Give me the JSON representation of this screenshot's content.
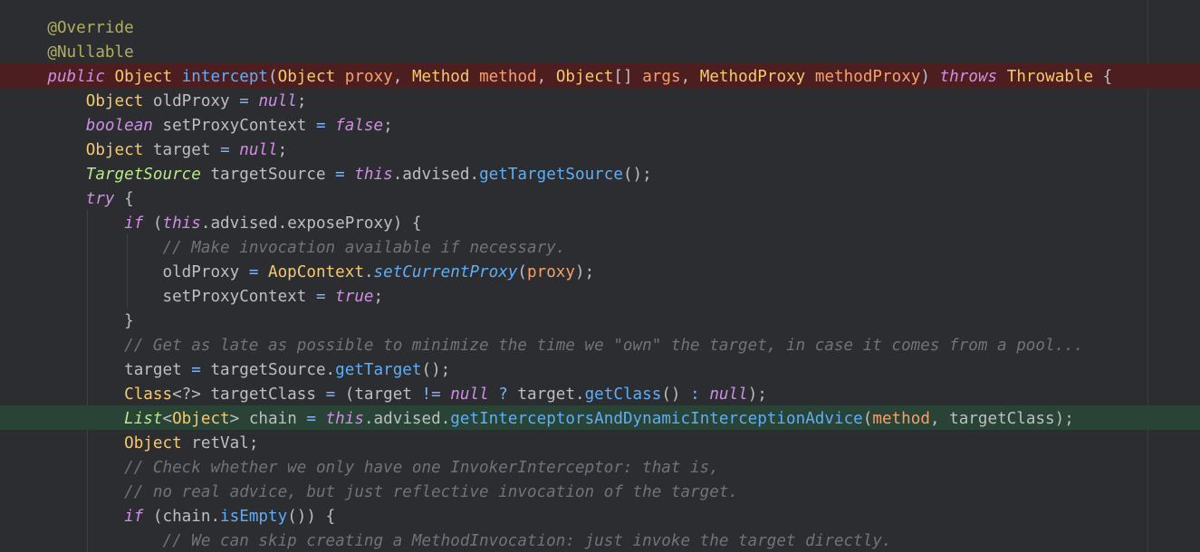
{
  "editor": {
    "language": "Java",
    "colors": {
      "background": "#2b2d30",
      "breakpoint_line": "#4d1e20",
      "execution_line": "#294436",
      "keyword": "#cf8ee4",
      "type": "#f7c86d",
      "parameter": "#f79f6c",
      "method_call": "#5fadf7",
      "comment": "#6f737a",
      "annotation": "#b3ae60"
    },
    "lines": [
      {
        "kind": "normal",
        "tokens": [
          {
            "t": "    ",
            "c": "punc"
          },
          {
            "t": "@Override",
            "c": "ann"
          }
        ]
      },
      {
        "kind": "normal",
        "tokens": [
          {
            "t": "    ",
            "c": "punc"
          },
          {
            "t": "@Nullable",
            "c": "ann"
          }
        ]
      },
      {
        "kind": "breakpoint",
        "tokens": [
          {
            "t": "    ",
            "c": "punc"
          },
          {
            "t": "public",
            "c": "kw"
          },
          {
            "t": " ",
            "c": "punc"
          },
          {
            "t": "Object",
            "c": "type"
          },
          {
            "t": " ",
            "c": "punc"
          },
          {
            "t": "intercept",
            "c": "method"
          },
          {
            "t": "(",
            "c": "punc"
          },
          {
            "t": "Object",
            "c": "type"
          },
          {
            "t": " ",
            "c": "punc"
          },
          {
            "t": "proxy",
            "c": "param"
          },
          {
            "t": ", ",
            "c": "punc"
          },
          {
            "t": "Method",
            "c": "type"
          },
          {
            "t": " ",
            "c": "punc"
          },
          {
            "t": "method",
            "c": "param"
          },
          {
            "t": ", ",
            "c": "punc"
          },
          {
            "t": "Object",
            "c": "type"
          },
          {
            "t": "[] ",
            "c": "punc"
          },
          {
            "t": "args",
            "c": "param"
          },
          {
            "t": ", ",
            "c": "punc"
          },
          {
            "t": "MethodProxy",
            "c": "type"
          },
          {
            "t": " ",
            "c": "punc"
          },
          {
            "t": "methodProxy",
            "c": "param"
          },
          {
            "t": ") ",
            "c": "punc"
          },
          {
            "t": "throws",
            "c": "kw"
          },
          {
            "t": " ",
            "c": "punc"
          },
          {
            "t": "Throwable",
            "c": "type"
          },
          {
            "t": " {",
            "c": "punc"
          }
        ]
      },
      {
        "kind": "normal",
        "tokens": [
          {
            "t": "        ",
            "c": "punc"
          },
          {
            "t": "Object",
            "c": "type"
          },
          {
            "t": " oldProxy ",
            "c": "punc"
          },
          {
            "t": "=",
            "c": "op"
          },
          {
            "t": " ",
            "c": "punc"
          },
          {
            "t": "null",
            "c": "kw"
          },
          {
            "t": ";",
            "c": "punc"
          }
        ]
      },
      {
        "kind": "normal",
        "tokens": [
          {
            "t": "        ",
            "c": "punc"
          },
          {
            "t": "boolean",
            "c": "kw"
          },
          {
            "t": " setProxyContext ",
            "c": "punc"
          },
          {
            "t": "=",
            "c": "op"
          },
          {
            "t": " ",
            "c": "punc"
          },
          {
            "t": "false",
            "c": "kw"
          },
          {
            "t": ";",
            "c": "punc"
          }
        ]
      },
      {
        "kind": "normal",
        "tokens": [
          {
            "t": "        ",
            "c": "punc"
          },
          {
            "t": "Object",
            "c": "type"
          },
          {
            "t": " target ",
            "c": "punc"
          },
          {
            "t": "=",
            "c": "op"
          },
          {
            "t": " ",
            "c": "punc"
          },
          {
            "t": "null",
            "c": "kw"
          },
          {
            "t": ";",
            "c": "punc"
          }
        ]
      },
      {
        "kind": "normal",
        "tokens": [
          {
            "t": "        ",
            "c": "punc"
          },
          {
            "t": "TargetSource",
            "c": "itype"
          },
          {
            "t": " targetSource ",
            "c": "punc"
          },
          {
            "t": "=",
            "c": "op"
          },
          {
            "t": " ",
            "c": "punc"
          },
          {
            "t": "this",
            "c": "kw"
          },
          {
            "t": ".advised.",
            "c": "punc"
          },
          {
            "t": "getTargetSource",
            "c": "method"
          },
          {
            "t": "();",
            "c": "punc"
          }
        ]
      },
      {
        "kind": "normal",
        "tokens": [
          {
            "t": "        ",
            "c": "punc"
          },
          {
            "t": "try",
            "c": "kw"
          },
          {
            "t": " {",
            "c": "punc"
          }
        ]
      },
      {
        "kind": "normal",
        "tokens": [
          {
            "t": "            ",
            "c": "punc"
          },
          {
            "t": "if",
            "c": "kw"
          },
          {
            "t": " (",
            "c": "punc"
          },
          {
            "t": "this",
            "c": "kw"
          },
          {
            "t": ".advised.exposeProxy) {",
            "c": "punc"
          }
        ]
      },
      {
        "kind": "normal",
        "tokens": [
          {
            "t": "                ",
            "c": "punc"
          },
          {
            "t": "// Make invocation available if necessary.",
            "c": "com"
          }
        ]
      },
      {
        "kind": "normal",
        "tokens": [
          {
            "t": "                oldProxy ",
            "c": "punc"
          },
          {
            "t": "=",
            "c": "op"
          },
          {
            "t": " ",
            "c": "punc"
          },
          {
            "t": "AopContext",
            "c": "type"
          },
          {
            "t": ".",
            "c": "punc"
          },
          {
            "t": "setCurrentProxy",
            "c": "smethod"
          },
          {
            "t": "(",
            "c": "punc"
          },
          {
            "t": "proxy",
            "c": "param"
          },
          {
            "t": ");",
            "c": "punc"
          }
        ]
      },
      {
        "kind": "normal",
        "tokens": [
          {
            "t": "                setProxyContext ",
            "c": "punc"
          },
          {
            "t": "=",
            "c": "op"
          },
          {
            "t": " ",
            "c": "punc"
          },
          {
            "t": "true",
            "c": "kw"
          },
          {
            "t": ";",
            "c": "punc"
          }
        ]
      },
      {
        "kind": "normal",
        "tokens": [
          {
            "t": "            }",
            "c": "punc"
          }
        ]
      },
      {
        "kind": "normal",
        "tokens": [
          {
            "t": "            ",
            "c": "punc"
          },
          {
            "t": "// Get as late as possible to minimize the time we \"own\" the target, in case it comes from a pool...",
            "c": "com"
          }
        ]
      },
      {
        "kind": "normal",
        "tokens": [
          {
            "t": "            target ",
            "c": "punc"
          },
          {
            "t": "=",
            "c": "op"
          },
          {
            "t": " targetSource.",
            "c": "punc"
          },
          {
            "t": "getTarget",
            "c": "method"
          },
          {
            "t": "();",
            "c": "punc"
          }
        ]
      },
      {
        "kind": "normal",
        "tokens": [
          {
            "t": "            ",
            "c": "punc"
          },
          {
            "t": "Class",
            "c": "type"
          },
          {
            "t": "<?> targetClass ",
            "c": "punc"
          },
          {
            "t": "=",
            "c": "op"
          },
          {
            "t": " (target ",
            "c": "punc"
          },
          {
            "t": "!=",
            "c": "op"
          },
          {
            "t": " ",
            "c": "punc"
          },
          {
            "t": "null",
            "c": "kw"
          },
          {
            "t": " ",
            "c": "punc"
          },
          {
            "t": "?",
            "c": "op"
          },
          {
            "t": " target.",
            "c": "punc"
          },
          {
            "t": "getClass",
            "c": "method"
          },
          {
            "t": "() ",
            "c": "punc"
          },
          {
            "t": ":",
            "c": "op"
          },
          {
            "t": " ",
            "c": "punc"
          },
          {
            "t": "null",
            "c": "kw"
          },
          {
            "t": ");",
            "c": "punc"
          }
        ]
      },
      {
        "kind": "exec",
        "tokens": [
          {
            "t": "            ",
            "c": "punc"
          },
          {
            "t": "List",
            "c": "itype"
          },
          {
            "t": "<",
            "c": "punc"
          },
          {
            "t": "Object",
            "c": "type"
          },
          {
            "t": "> chain ",
            "c": "punc"
          },
          {
            "t": "=",
            "c": "op"
          },
          {
            "t": " ",
            "c": "punc"
          },
          {
            "t": "this",
            "c": "kw"
          },
          {
            "t": ".advised.",
            "c": "punc"
          },
          {
            "t": "getInterceptorsAndDynamicInterceptionAdvice",
            "c": "method"
          },
          {
            "t": "(",
            "c": "punc"
          },
          {
            "t": "method",
            "c": "param"
          },
          {
            "t": ", targetClass);",
            "c": "punc"
          }
        ]
      },
      {
        "kind": "normal",
        "tokens": [
          {
            "t": "            ",
            "c": "punc"
          },
          {
            "t": "Object",
            "c": "type"
          },
          {
            "t": " retVal;",
            "c": "punc"
          }
        ]
      },
      {
        "kind": "normal",
        "tokens": [
          {
            "t": "            ",
            "c": "punc"
          },
          {
            "t": "// Check whether we only have one InvokerInterceptor: that is,",
            "c": "com"
          }
        ]
      },
      {
        "kind": "normal",
        "tokens": [
          {
            "t": "            ",
            "c": "punc"
          },
          {
            "t": "// no real advice, but just reflective invocation of the target.",
            "c": "com"
          }
        ]
      },
      {
        "kind": "normal",
        "tokens": [
          {
            "t": "            ",
            "c": "punc"
          },
          {
            "t": "if",
            "c": "kw"
          },
          {
            "t": " (chain.",
            "c": "punc"
          },
          {
            "t": "isEmpty",
            "c": "method"
          },
          {
            "t": "()) {",
            "c": "punc"
          }
        ]
      },
      {
        "kind": "normal",
        "tokens": [
          {
            "t": "                ",
            "c": "punc"
          },
          {
            "t": "// We can skip creating a MethodInvocation: just invoke the target directly.",
            "c": "com"
          }
        ]
      }
    ]
  }
}
